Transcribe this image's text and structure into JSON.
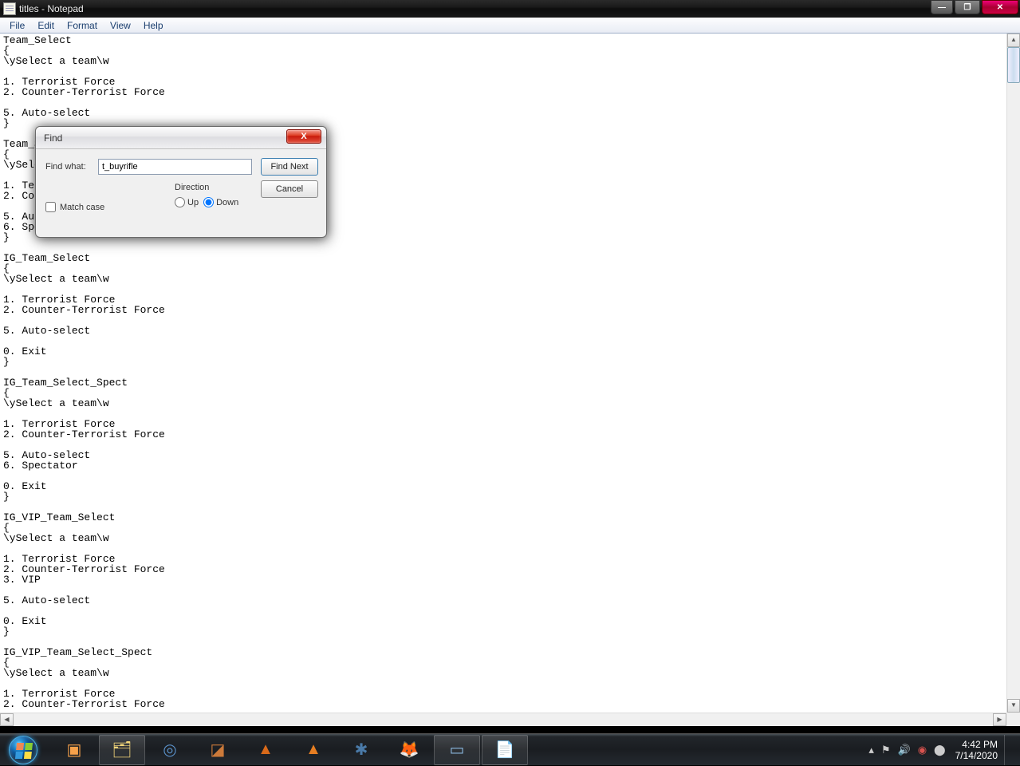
{
  "window": {
    "title": "titles - Notepad"
  },
  "menus": {
    "file": "File",
    "edit": "Edit",
    "format": "Format",
    "view": "View",
    "help": "Help"
  },
  "editor": {
    "content": "Team_Select\n{\n\\ySelect a team\\w\n\n1. Terrorist Force\n2. Counter-Terrorist Force\n\n5. Auto-select\n}\n\nTeam_Select_Spect\n{\n\\ySelect a team\\w\n\n1. Terrorist Force\n2. Counter-Terrorist Force\n\n5. Auto-select\n6. Spectator\n}\n\nIG_Team_Select\n{\n\\ySelect a team\\w\n\n1. Terrorist Force\n2. Counter-Terrorist Force\n\n5. Auto-select\n\n0. Exit\n}\n\nIG_Team_Select_Spect\n{\n\\ySelect a team\\w\n\n1. Terrorist Force\n2. Counter-Terrorist Force\n\n5. Auto-select\n6. Spectator\n\n0. Exit\n}\n\nIG_VIP_Team_Select\n{\n\\ySelect a team\\w\n\n1. Terrorist Force\n2. Counter-Terrorist Force\n3. VIP\n\n5. Auto-select\n\n0. Exit\n}\n\nIG_VIP_Team_Select_Spect\n{\n\\ySelect a team\\w\n\n1. Terrorist Force\n2. Counter-Terrorist Force"
  },
  "find": {
    "title": "Find",
    "find_what_label": "Find what:",
    "find_what_value": "t_buyrifle",
    "find_next": "Find Next",
    "cancel": "Cancel",
    "direction_label": "Direction",
    "up": "Up",
    "down": "Down",
    "match_case": "Match case"
  },
  "systray": {
    "time": "4:42 PM",
    "date": "7/14/2020"
  }
}
